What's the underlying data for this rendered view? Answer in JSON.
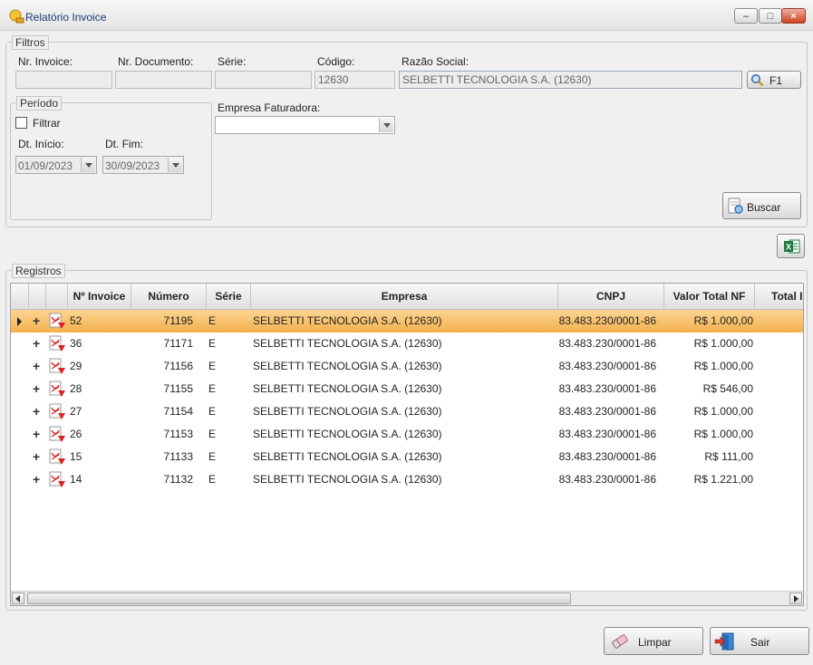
{
  "window": {
    "title": "Relatório Invoice",
    "min_glyph": "–",
    "max_glyph": "□",
    "close_glyph": "×"
  },
  "filtros": {
    "legend": "Filtros",
    "nr_invoice": {
      "label": "Nr. Invoice:",
      "value": ""
    },
    "nr_documento": {
      "label": "Nr. Documento:",
      "value": ""
    },
    "serie": {
      "label": "Série:",
      "value": ""
    },
    "codigo": {
      "label": "Código:",
      "value": "12630"
    },
    "razao_social": {
      "label": "Razão Social:",
      "value": "SELBETTI TECNOLOGIA S.A. (12630)"
    },
    "f1_label": "F1",
    "periodo": {
      "legend": "Período",
      "filtrar_label": "Filtrar",
      "filtrar_checked": false,
      "dt_inicio": {
        "label": "Dt. Início:",
        "value": "01/09/2023"
      },
      "dt_fim": {
        "label": "Dt. Fim:",
        "value": "30/09/2023"
      }
    },
    "empresa_faturadora": {
      "label": "Empresa Faturadora:",
      "value": ""
    },
    "buscar_label": "Buscar"
  },
  "excel_icon": "excel-icon",
  "registros": {
    "legend": "Registros",
    "columns": [
      "",
      "",
      "",
      "Nº Invoice",
      "Número",
      "Série",
      "Empresa",
      "CNPJ",
      "Valor Total NF",
      "Total I"
    ],
    "rows": [
      {
        "invoice": "52",
        "numero": "71195",
        "serie": "E",
        "empresa": "SELBETTI TECNOLOGIA S.A. (12630)",
        "cnpj": "83.483.230/0001-86",
        "valor": "R$ 1.000,00"
      },
      {
        "invoice": "36",
        "numero": "71171",
        "serie": "E",
        "empresa": "SELBETTI TECNOLOGIA S.A. (12630)",
        "cnpj": "83.483.230/0001-86",
        "valor": "R$ 1.000,00"
      },
      {
        "invoice": "29",
        "numero": "71156",
        "serie": "E",
        "empresa": "SELBETTI TECNOLOGIA S.A. (12630)",
        "cnpj": "83.483.230/0001-86",
        "valor": "R$ 1.000,00"
      },
      {
        "invoice": "28",
        "numero": "71155",
        "serie": "E",
        "empresa": "SELBETTI TECNOLOGIA S.A. (12630)",
        "cnpj": "83.483.230/0001-86",
        "valor": "R$ 546,00"
      },
      {
        "invoice": "27",
        "numero": "71154",
        "serie": "E",
        "empresa": "SELBETTI TECNOLOGIA S.A. (12630)",
        "cnpj": "83.483.230/0001-86",
        "valor": "R$ 1.000,00"
      },
      {
        "invoice": "26",
        "numero": "71153",
        "serie": "E",
        "empresa": "SELBETTI TECNOLOGIA S.A. (12630)",
        "cnpj": "83.483.230/0001-86",
        "valor": "R$ 1.000,00"
      },
      {
        "invoice": "15",
        "numero": "71133",
        "serie": "E",
        "empresa": "SELBETTI TECNOLOGIA S.A. (12630)",
        "cnpj": "83.483.230/0001-86",
        "valor": "R$ 111,00"
      },
      {
        "invoice": "14",
        "numero": "71132",
        "serie": "E",
        "empresa": "SELBETTI TECNOLOGIA S.A. (12630)",
        "cnpj": "83.483.230/0001-86",
        "valor": "R$ 1.221,00"
      }
    ],
    "selected_row": 0,
    "expand_glyph": "+"
  },
  "footer": {
    "limpar_label": "Limpar",
    "sair_label": "Sair"
  },
  "colors": {
    "selected_row": "#f4b04c",
    "title_text": "#1c3c70"
  }
}
